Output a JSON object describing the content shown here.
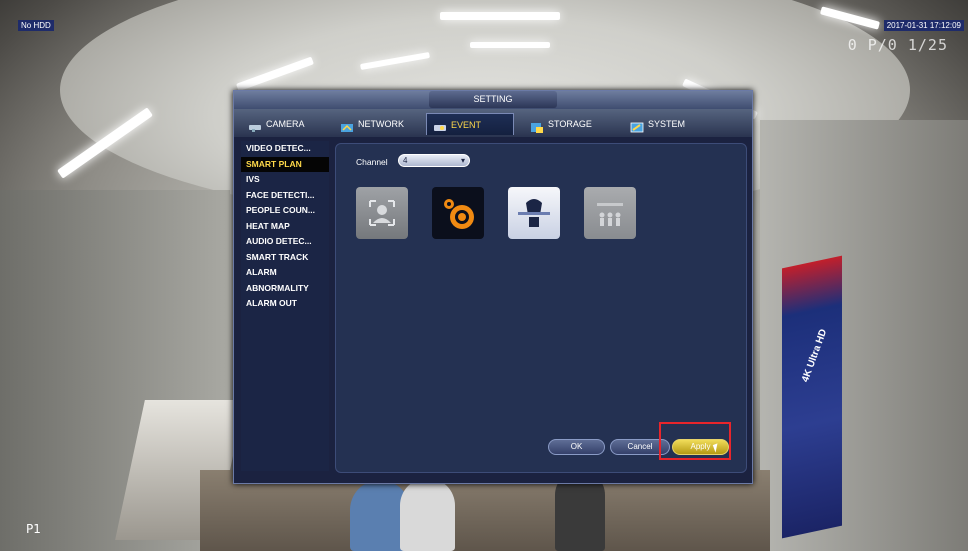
{
  "camera_overlay": {
    "hdd_status": "No HDD",
    "timestamp": "2017-01-31 17:12:09",
    "timestamp_ghost": "0 P/0 1/25",
    "channel_corner": "P1",
    "banner_text": "4K Ultra HD"
  },
  "dialog": {
    "title": "SETTING",
    "tabs": [
      {
        "label": "CAMERA",
        "icon": "camera-icon",
        "active": false
      },
      {
        "label": "NETWORK",
        "icon": "network-icon",
        "active": false
      },
      {
        "label": "EVENT",
        "icon": "event-icon",
        "active": true
      },
      {
        "label": "STORAGE",
        "icon": "storage-icon",
        "active": false
      },
      {
        "label": "SYSTEM",
        "icon": "system-icon",
        "active": false
      }
    ],
    "sidebar": [
      {
        "label": "VIDEO DETEC...",
        "active": false
      },
      {
        "label": "SMART PLAN",
        "active": true
      },
      {
        "label": "IVS",
        "active": false
      },
      {
        "label": "FACE DETECTI...",
        "active": false
      },
      {
        "label": "PEOPLE COUN...",
        "active": false
      },
      {
        "label": "HEAT MAP",
        "active": false
      },
      {
        "label": "AUDIO DETEC...",
        "active": false
      },
      {
        "label": "SMART TRACK",
        "active": false
      },
      {
        "label": "ALARM",
        "active": false
      },
      {
        "label": "ABNORMALITY",
        "active": false
      },
      {
        "label": "ALARM OUT",
        "active": false
      }
    ],
    "channel": {
      "label": "Channel",
      "value": "4"
    },
    "plans": [
      {
        "icon": "face-detection-icon",
        "state": "disabled"
      },
      {
        "icon": "heat-map-icon",
        "state": "selected"
      },
      {
        "icon": "ivs-icon",
        "state": "enabled"
      },
      {
        "icon": "people-counting-icon",
        "state": "disabled"
      }
    ],
    "buttons": {
      "ok": "OK",
      "cancel": "Cancel",
      "apply": "Apply"
    }
  },
  "colors": {
    "active_tab_text": "#ffd94a",
    "dialog_bg": "#1b2240",
    "highlight_box": "#e8252b"
  }
}
